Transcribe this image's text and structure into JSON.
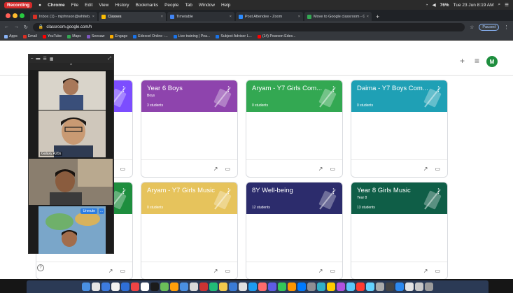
{
  "menubar": {
    "recording": "Recording",
    "app": "Chrome",
    "menus": [
      "File",
      "Edit",
      "View",
      "History",
      "Bookmarks",
      "People",
      "Tab",
      "Window",
      "Help"
    ],
    "battery": "76%",
    "clock": "Tue 23 Jun  8:19 AM"
  },
  "tabs": [
    {
      "label": "Inbox (1) - mjohnson@whiteb...",
      "color": "#d93025"
    },
    {
      "label": "Classes",
      "color": "#fbbc04",
      "active": true
    },
    {
      "label": "Timetable",
      "color": "#4285f4"
    },
    {
      "label": "Post Attendee - Zoom",
      "color": "#2d8cff"
    },
    {
      "label": "Move to Google classroom - G...",
      "color": "#34a853"
    }
  ],
  "address": {
    "url": "classroom.google.com/h",
    "paused": "Paused"
  },
  "bookmarks": [
    {
      "label": "Apps",
      "color": "#8ab4f8"
    },
    {
      "label": "Email",
      "color": "#d93025"
    },
    {
      "label": "YouTube",
      "color": "#ff0000"
    },
    {
      "label": "Maps",
      "color": "#34a853"
    },
    {
      "label": "Seesaw",
      "color": "#7e57c2"
    },
    {
      "label": "Engage",
      "color": "#f9ab00"
    },
    {
      "label": "Edexcel Online -...",
      "color": "#1a73e8"
    },
    {
      "label": "Live training | Pea...",
      "color": "#1a73e8"
    },
    {
      "label": "Subject Advisor L...",
      "color": "#1a73e8"
    },
    {
      "label": "(14) Pearson Edex...",
      "color": "#ff0000"
    }
  ],
  "header": {
    "add_icon": "+",
    "apps_icon": "≡",
    "avatar": "M"
  },
  "cards": [
    {
      "name": "",
      "section": "",
      "students": "",
      "color": "#7c4dff",
      "partial": true
    },
    {
      "name": "Year 6 Boys",
      "section": "Boys",
      "students": "3 students",
      "color": "#8e44ad"
    },
    {
      "name": "Aryam - Y7 Girls Com...",
      "section": "",
      "students": "0 students",
      "color": "#33a852"
    },
    {
      "name": "Daima - Y7 Boys Com...",
      "section": "",
      "students": "0 students",
      "color": "#1fa0b5"
    },
    {
      "name": "",
      "section": "",
      "students": "",
      "color": "#1e8e3e",
      "partial": true
    },
    {
      "name": "Aryam - Y7 Girls Music",
      "section": "",
      "students": "0 students",
      "color": "#e6c35c"
    },
    {
      "name": "8Y Well-being",
      "section": "",
      "students": "12 students",
      "color": "#2c2c6c"
    },
    {
      "name": "Year 8 Girls Music",
      "section": "Year 8",
      "students": "13 students",
      "color": "#0f5e47"
    }
  ],
  "call": {
    "participants": [
      {
        "name": ""
      },
      {
        "name": "Galaxy A20s"
      },
      {
        "name": ""
      },
      {
        "name": ""
      }
    ],
    "unmute": "Unmute",
    "more": "..."
  },
  "help": "?"
}
